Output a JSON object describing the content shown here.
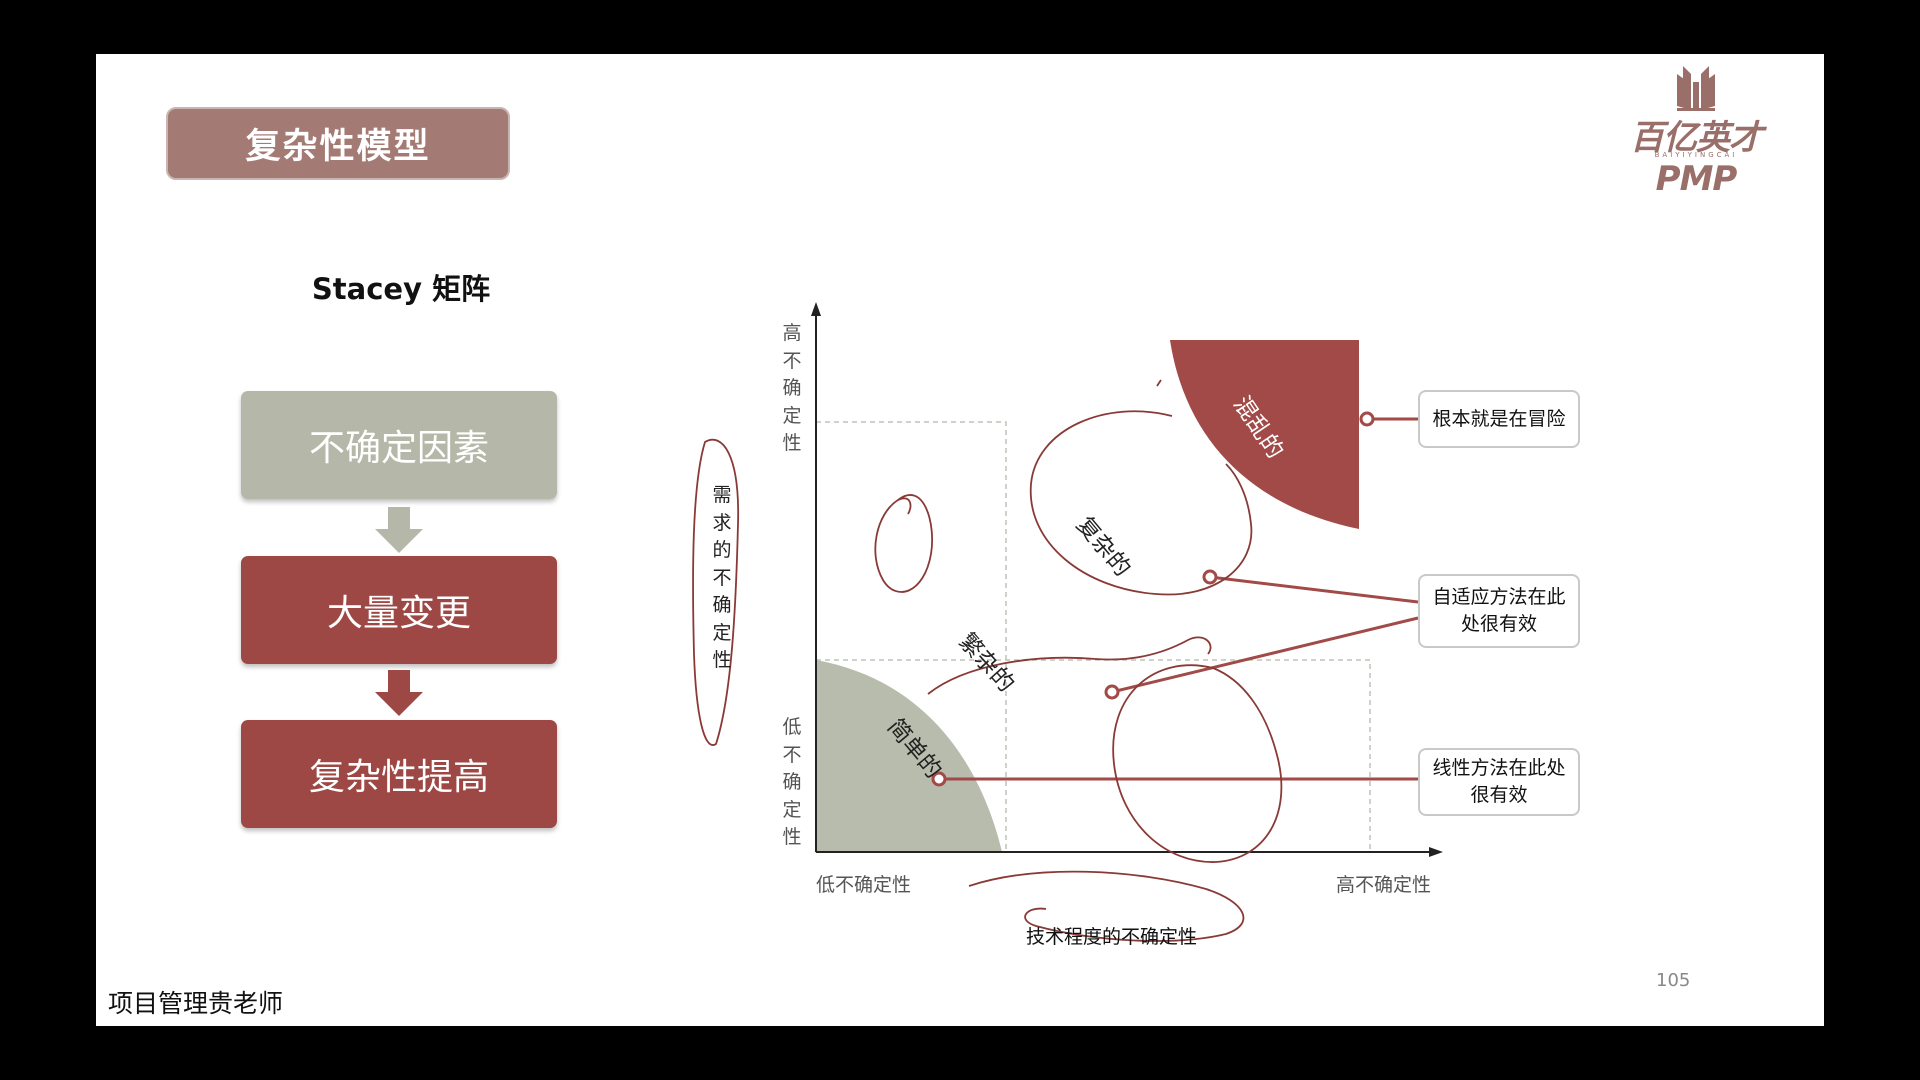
{
  "title": "复杂性模型",
  "logo": {
    "text": "百亿英才PMP",
    "sub": "BAIYIYINGCAI"
  },
  "subtitle": "Stacey 矩阵",
  "flow": [
    "不确定因素",
    "大量变更",
    "复杂性提高"
  ],
  "diagram": {
    "y_axis_top": "高不确定性",
    "y_axis_bottom": "低不确定性",
    "y_axis_title": "需求的不确定性",
    "x_axis_left": "低不确定性",
    "x_axis_right": "高不确定性",
    "x_axis_title": "技术程度的不确定性",
    "regions": {
      "chaotic": "混乱的",
      "complex": "复杂的",
      "complicated": "繁杂的",
      "simple": "简单的"
    },
    "callouts": [
      "根本就是在冒险",
      "自适应方法在此处很有效",
      "线性方法在此处很有效"
    ]
  },
  "colors": {
    "title_bg": "#a47a74",
    "flow_grey": "#b5b8a8",
    "flow_red": "#9e4845",
    "chaotic_fill": "#a14a47",
    "simple_fill": "#b8bcad",
    "pen": "#8a3a36"
  },
  "footer": "项目管理贵老师",
  "page_number": "105"
}
